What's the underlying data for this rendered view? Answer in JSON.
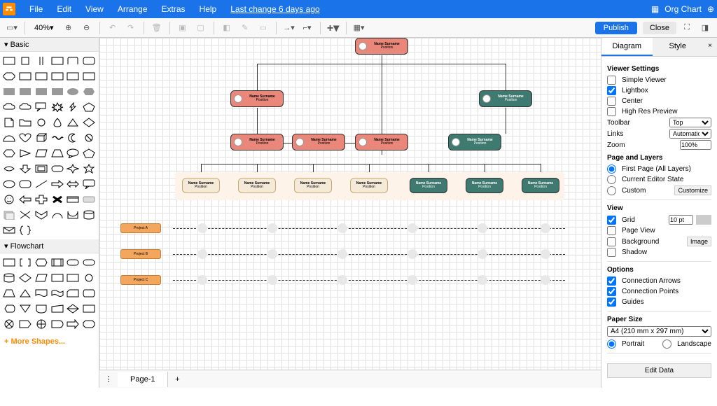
{
  "menubar": {
    "items": [
      "File",
      "Edit",
      "View",
      "Arrange",
      "Extras",
      "Help"
    ],
    "last_change": "Last change 6 days ago",
    "title": "Org Chart"
  },
  "toolbar": {
    "zoom": "40%",
    "publish": "Publish",
    "close": "Close"
  },
  "shapes": {
    "sections": [
      "Basic",
      "Flowchart"
    ],
    "more": "+ More Shapes..."
  },
  "tabs": {
    "page1": "Page-1"
  },
  "right_panel": {
    "tabs": {
      "diagram": "Diagram",
      "style": "Style"
    },
    "viewer_settings": "Viewer Settings",
    "simple_viewer": "Simple Viewer",
    "lightbox": "Lightbox",
    "center": "Center",
    "high_res": "High Res Preview",
    "toolbar": "Toolbar",
    "toolbar_val": "Top",
    "links": "Links",
    "links_val": "Automatic",
    "zoom": "Zoom",
    "zoom_val": "100%",
    "page_layers": "Page and Layers",
    "first_page": "First Page (All Layers)",
    "current_editor": "Current Editor State",
    "custom": "Custom",
    "customize": "Customize",
    "view": "View",
    "grid": "Grid",
    "grid_val": "10 pt",
    "page_view": "Page View",
    "background": "Background",
    "image": "Image",
    "shadow": "Shadow",
    "options": "Options",
    "conn_arrows": "Connection Arrows",
    "conn_points": "Connection Points",
    "guides": "Guides",
    "paper_size": "Paper Size",
    "paper_val": "A4 (210 mm x 297 mm)",
    "portrait": "Portrait",
    "landscape": "Landscape",
    "edit_data": "Edit Data"
  },
  "org": {
    "node_name": "Name Surname",
    "node_pos": "Position",
    "projects": [
      "Project A",
      "Project B",
      "Project C"
    ]
  }
}
